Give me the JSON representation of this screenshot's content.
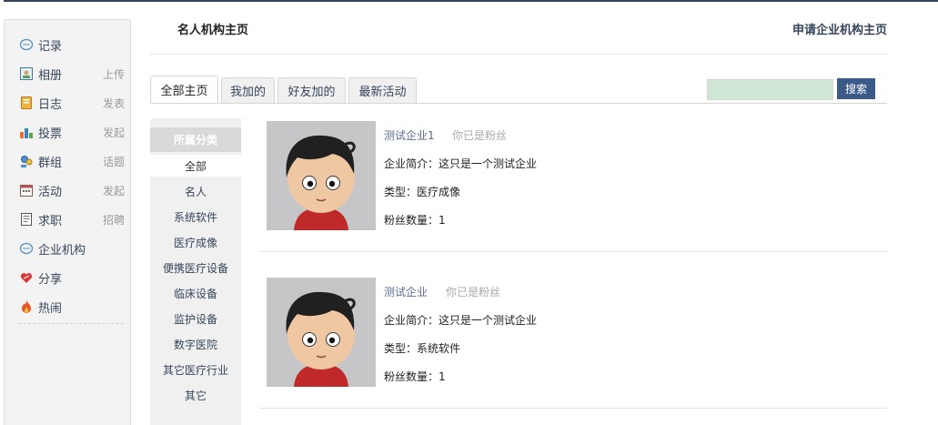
{
  "sidebar": {
    "items": [
      {
        "label": "记录",
        "action": "",
        "icon": "chat-bubble-icon"
      },
      {
        "label": "相册",
        "action": "上传",
        "icon": "photo-icon"
      },
      {
        "label": "日志",
        "action": "发表",
        "icon": "notebook-icon"
      },
      {
        "label": "投票",
        "action": "发起",
        "icon": "bar-chart-icon"
      },
      {
        "label": "群组",
        "action": "话题",
        "icon": "group-icon"
      },
      {
        "label": "活动",
        "action": "发起",
        "icon": "calendar-icon"
      },
      {
        "label": "求职",
        "action": "招聘",
        "icon": "document-icon"
      },
      {
        "label": "企业机构",
        "action": "",
        "icon": "chat-bubble-icon"
      },
      {
        "label": "分享",
        "action": "",
        "icon": "heart-share-icon"
      },
      {
        "label": "热闹",
        "action": "",
        "icon": "fire-icon"
      }
    ]
  },
  "header": {
    "title": "名人机构主页",
    "apply_link": "申请企业机构主页"
  },
  "tabs": [
    {
      "label": "全部主页",
      "active": true
    },
    {
      "label": "我加的",
      "active": false
    },
    {
      "label": "好友加的",
      "active": false
    },
    {
      "label": "最新活动",
      "active": false
    }
  ],
  "search": {
    "button": "搜索",
    "value": ""
  },
  "categories": {
    "heading": "所属分类",
    "items": [
      "全部",
      "名人",
      "系统软件",
      "医疗成像",
      "便携医疗设备",
      "临床设备",
      "监护设备",
      "数字医院",
      "其它医疗行业",
      "其它"
    ],
    "selected": "全部"
  },
  "entries": [
    {
      "name": "测试企业1",
      "fan_status": "你已是粉丝",
      "intro": "企业简介：这只是一个测试企业",
      "type": "类型：医疗成像",
      "fans": "粉丝数量：1"
    },
    {
      "name": "测试企业",
      "fan_status": "你已是粉丝",
      "intro": "企业简介：这只是一个测试企业",
      "type": "类型：系统软件",
      "fans": "粉丝数量：1"
    }
  ],
  "colors": {
    "accent": "#36465a",
    "search_button": "#3b5a88",
    "search_field": "#cfe6d4",
    "category_panel": "#f0f0f0"
  }
}
